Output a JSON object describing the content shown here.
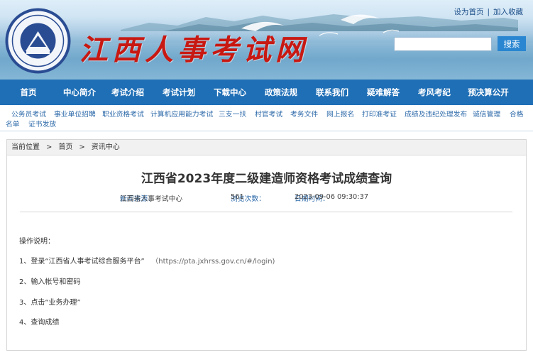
{
  "header": {
    "site_title": "江西人事考试网",
    "top_links": [
      "设为首页",
      "加入收藏"
    ],
    "search_button": "搜索",
    "search_placeholder": ""
  },
  "nav": {
    "items": [
      "首页",
      "中心简介",
      "考试介绍",
      "考试计划",
      "下载中心",
      "政策法规",
      "联系我们",
      "疑难解答",
      "考风考纪",
      "预决算公开"
    ]
  },
  "subnav": {
    "items": [
      "公务员考试",
      "事业单位招聘",
      "职业资格考试",
      "计算机应用能力考试",
      "三支一扶",
      "村官考试",
      "考务文件",
      "网上报名",
      "打印准考证",
      "成绩及违纪处理发布",
      "诚信管理",
      "合格",
      "名单",
      "证书发放"
    ]
  },
  "breadcrumb": {
    "items": [
      "当前位置",
      "首页",
      "资讯中心"
    ],
    "separator": ">"
  },
  "article": {
    "title": "江西省2023年度二级建造师资格考试成绩查询",
    "source_label": "新闻来源：",
    "source_value": "江西省人事考试中心",
    "views_label": "浏览次数：",
    "views_value": "561",
    "date_label": "日期时间：",
    "date_value": "2023-09-06 09:30:37",
    "intro": "操作说明：",
    "step1_text": "1、登录“江西省人事考试综合服务平台”",
    "step1_url": "（https://pta.jxhrss.gov.cn/#/login)",
    "step2": "2、输入帐号和密码",
    "step3": "3、点击“业务办理”",
    "step4": "4、查询成绩"
  },
  "colors": {
    "nav_bg": "#1f6fb6",
    "link": "#2d6aa9",
    "title_red": "#c81812",
    "search_btn": "#2a86d1"
  }
}
